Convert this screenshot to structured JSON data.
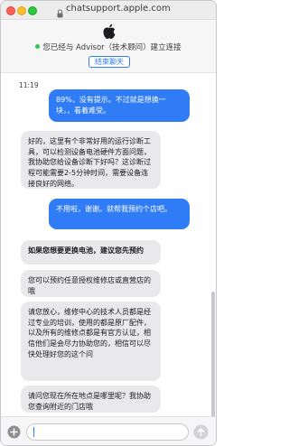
{
  "browser": {
    "url": "chatsupport.apple.com"
  },
  "header": {
    "status_text": "您已经与 Advisor（技术顾问）建立连接",
    "end_chat_label": "结束聊天",
    "status_color": "#32c55a"
  },
  "chat": {
    "timestamp": "11:19",
    "messages": [
      {
        "from": "user",
        "text": "89%，没有提示。不过就是想换一块，，看着难受。"
      },
      {
        "from": "advisor",
        "text": "好的，这里有个非常好用的运行诊断工具，可以检测设备电池硬件方面问题，我协助您给设备诊断下好吗？这诊断过程可能需要2-5分钟时间，需要设备连接良好的网络。"
      },
      {
        "from": "user",
        "text": "不用啦，谢谢。就帮我预约个店吧。"
      },
      {
        "from": "advisor",
        "text": "如果您想要更换电池，建议您先预约"
      },
      {
        "from": "advisor",
        "text": "您可以预约任意授权维修店或直营店的哦"
      },
      {
        "from": "advisor",
        "text": "请您放心，维修中心的技术人员都是经过专业的培训，使用的都是原厂配件，以及所有的维修点都是有官方认证，相信他们是会尽力协助您的，相信可以尽快处理好您的这个问"
      },
      {
        "from": "advisor",
        "text": "请问您现在所在地点是哪里呢？我协助您查询附近的门店哦"
      }
    ]
  },
  "composer": {
    "value": "",
    "placeholder": ""
  },
  "colors": {
    "accent": "#2f7cf6",
    "advisor_bubble": "#e9e9eb"
  },
  "icons": {
    "lock": "lock-icon",
    "brand": "apple-logo-icon",
    "attach": "plus-circle-icon",
    "send": "send-arrow-icon"
  }
}
